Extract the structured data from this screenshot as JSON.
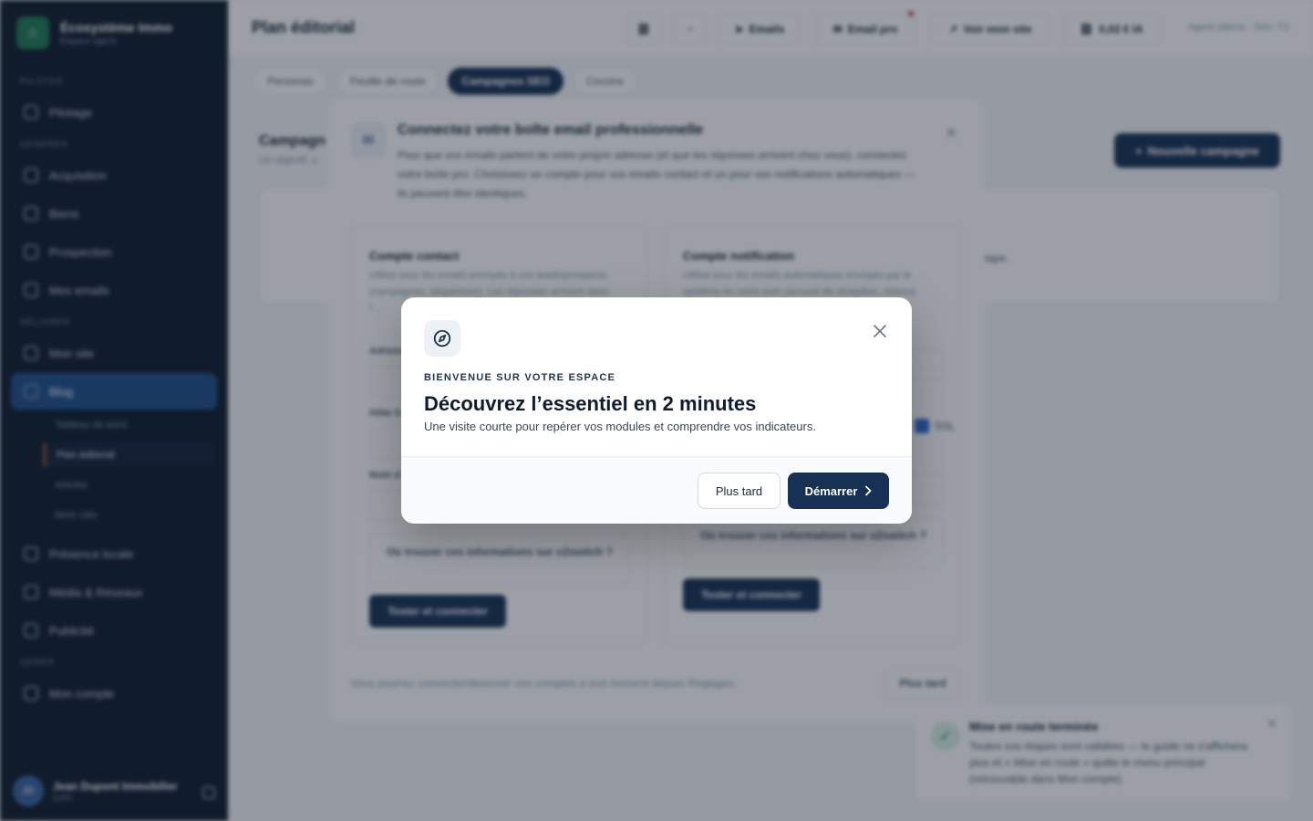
{
  "sidebar": {
    "brand_name": "Écosystème Immo",
    "brand_sub": "Espace agent",
    "sections": [
      "PILOTER",
      "GÉNÉRER",
      "DÉLIVRER",
      "GÉRER"
    ],
    "items": [
      {
        "label": "Pilotage"
      },
      {
        "label": "Acquisition"
      },
      {
        "label": "Biens"
      },
      {
        "label": "Prospection"
      },
      {
        "label": "Mes emails"
      },
      {
        "label": "Mon site"
      },
      {
        "label": "Blog"
      },
      {
        "label": "Présence locale"
      },
      {
        "label": "Média & Réseaux"
      },
      {
        "label": "Publicité"
      },
      {
        "label": "Mon compte"
      }
    ],
    "blog_sub": [
      "Tableau de bord",
      "Plan éditorial",
      "Articles",
      "Mots clés"
    ],
    "user": {
      "initials": "JD",
      "name": "Jean Dupont Immobilier",
      "city": "Lyon"
    }
  },
  "topbar": {
    "title": "Plan éditorial",
    "emails": "Emails",
    "email_pro": "Email pro",
    "voir_site": "Voir mon site",
    "ia_cost": "0,02 € IA",
    "account": "Agent (démo · Dév. TI)"
  },
  "tabs": [
    "Personas",
    "Feuille de route",
    "Campagnes SEO",
    "Cocons"
  ],
  "background": {
    "heading": "Campagn",
    "sub": "Un objectif, u",
    "new_campaign": "Nouvelle campagne",
    "step_text": "tape."
  },
  "email_modal": {
    "title": "Connectez votre boîte email professionnelle",
    "desc": "Pour que vos emails partent de votre propre adresse (et que les réponses arrivent chez vous), connectez votre boîte pro. Choisissez un compte pour vos emails contact et un pour vos notifications automatiques — ils peuvent être identiques.",
    "contact_title": "Compte contact",
    "contact_desc": "Utilisé pour les emails envoyés à vos leads/prospects (campagnes, séquences). Les réponses arrivent dans l…",
    "notif_title": "Compte notification",
    "notif_desc": "Utilisé pour les emails automatiques envoyés par le système en votre nom (accusé de réception, relance",
    "field_labels": [
      "Adresse",
      "Hôte S",
      "Nom d"
    ],
    "help": "Où trouver ces informations sur o2switch ?",
    "connect": "Tester et connecter",
    "ssl": "SSL",
    "footer": "Vous pourrez connecter/dissocier ces comptes à tout moment depuis Réglages.",
    "later": "Plus tard"
  },
  "toast": {
    "title": "Mise en route terminée",
    "body": "Toutes vos étapes sont validées — le guide ne s'affichera plus et « Mise en route » quitte le menu principal (retrouvable dans Mon compte)."
  },
  "welcome": {
    "eyebrow": "BIENVENUE SUR VOTRE ESPACE",
    "title": "Découvrez l’essentiel en 2 minutes",
    "description": "Une visite courte pour repérer vos modules et comprendre vos indicateurs.",
    "later_label": "Plus tard",
    "start_label": "Démarrer",
    "icon": "compass-icon",
    "accent": "#173154"
  }
}
